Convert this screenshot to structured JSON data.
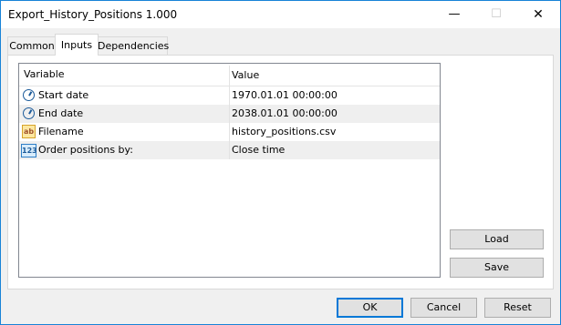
{
  "window": {
    "title": "Export_History_Positions 1.000"
  },
  "titlebar_icons": {
    "minimize": "minimize-icon",
    "maximize": "maximize-icon",
    "close": "close-icon"
  },
  "tabs": [
    {
      "label": "Common"
    },
    {
      "label": "Inputs",
      "selected": true
    },
    {
      "label": "Dependencies"
    }
  ],
  "grid": {
    "headers": {
      "variable": "Variable",
      "value": "Value"
    },
    "rows": [
      {
        "icon": "clock-icon",
        "variable": "Start date",
        "value": "1970.01.01 00:00:00"
      },
      {
        "icon": "clock-icon",
        "variable": "End date",
        "value": "2038.01.01 00:00:00"
      },
      {
        "icon": "text-ab-icon",
        "icon_text": "ab",
        "variable": "Filename",
        "value": "history_positions.csv"
      },
      {
        "icon": "enum-123-icon",
        "icon_text": "123",
        "variable": "Order positions by:",
        "value": "Close time"
      }
    ]
  },
  "side_buttons": {
    "load": "Load",
    "save": "Save"
  },
  "footer_buttons": {
    "ok": "OK",
    "cancel": "Cancel",
    "reset": "Reset"
  }
}
